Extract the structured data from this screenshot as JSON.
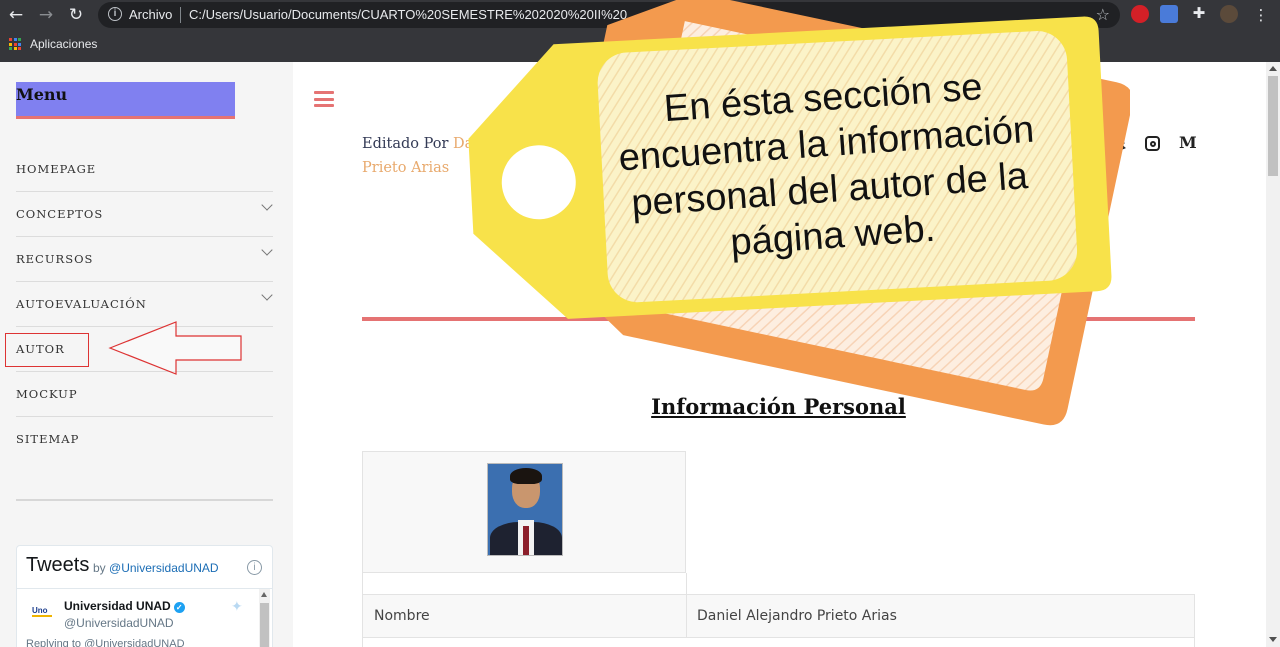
{
  "browser": {
    "address_label": "Archivo",
    "url": "C:/Users/Usuario/Documents/CUARTO%20SEMESTRE%202020%20II%20...",
    "bookmarks_label": "Aplicaciones"
  },
  "sidebar": {
    "title": "Menu",
    "items": [
      {
        "label": "HOMEPAGE",
        "has_children": false
      },
      {
        "label": "CONCEPTOS",
        "has_children": true
      },
      {
        "label": "RECURSOS",
        "has_children": true
      },
      {
        "label": "AUTOEVALUACIÓN",
        "has_children": true
      },
      {
        "label": "AUTOR",
        "has_children": false
      },
      {
        "label": "MOCKUP",
        "has_children": false
      },
      {
        "label": "SITEMAP",
        "has_children": false
      }
    ],
    "highlighted_item": "AUTOR"
  },
  "tweets": {
    "title": "Tweets",
    "by": "by",
    "handle": "@UniversidadUNAD",
    "tweet_author": "Universidad UNAD",
    "tweet_user": "@UniversidadUNAD",
    "reply_text": "Replying to @UniversidadUNAD"
  },
  "main": {
    "byline_prefix": "Editado Por",
    "byline_name": "Daniel Alejandro Prieto Arias",
    "social_letter": "M",
    "section_title": "Información Personal",
    "table": {
      "rows": [
        {
          "key": "Nombre",
          "value": "Daniel Alejandro Prieto Arias"
        }
      ]
    }
  },
  "callout": {
    "text": "En ésta sección se encuentra la información personal del autor de la página web.",
    "colors": {
      "front": "#f8e24a",
      "back": "#f39a4e",
      "inner": "#fbf3c8"
    }
  },
  "colors": {
    "accent_red": "#e57373",
    "menu_header": "#8080f0",
    "byline_name": "#e8a96c"
  }
}
